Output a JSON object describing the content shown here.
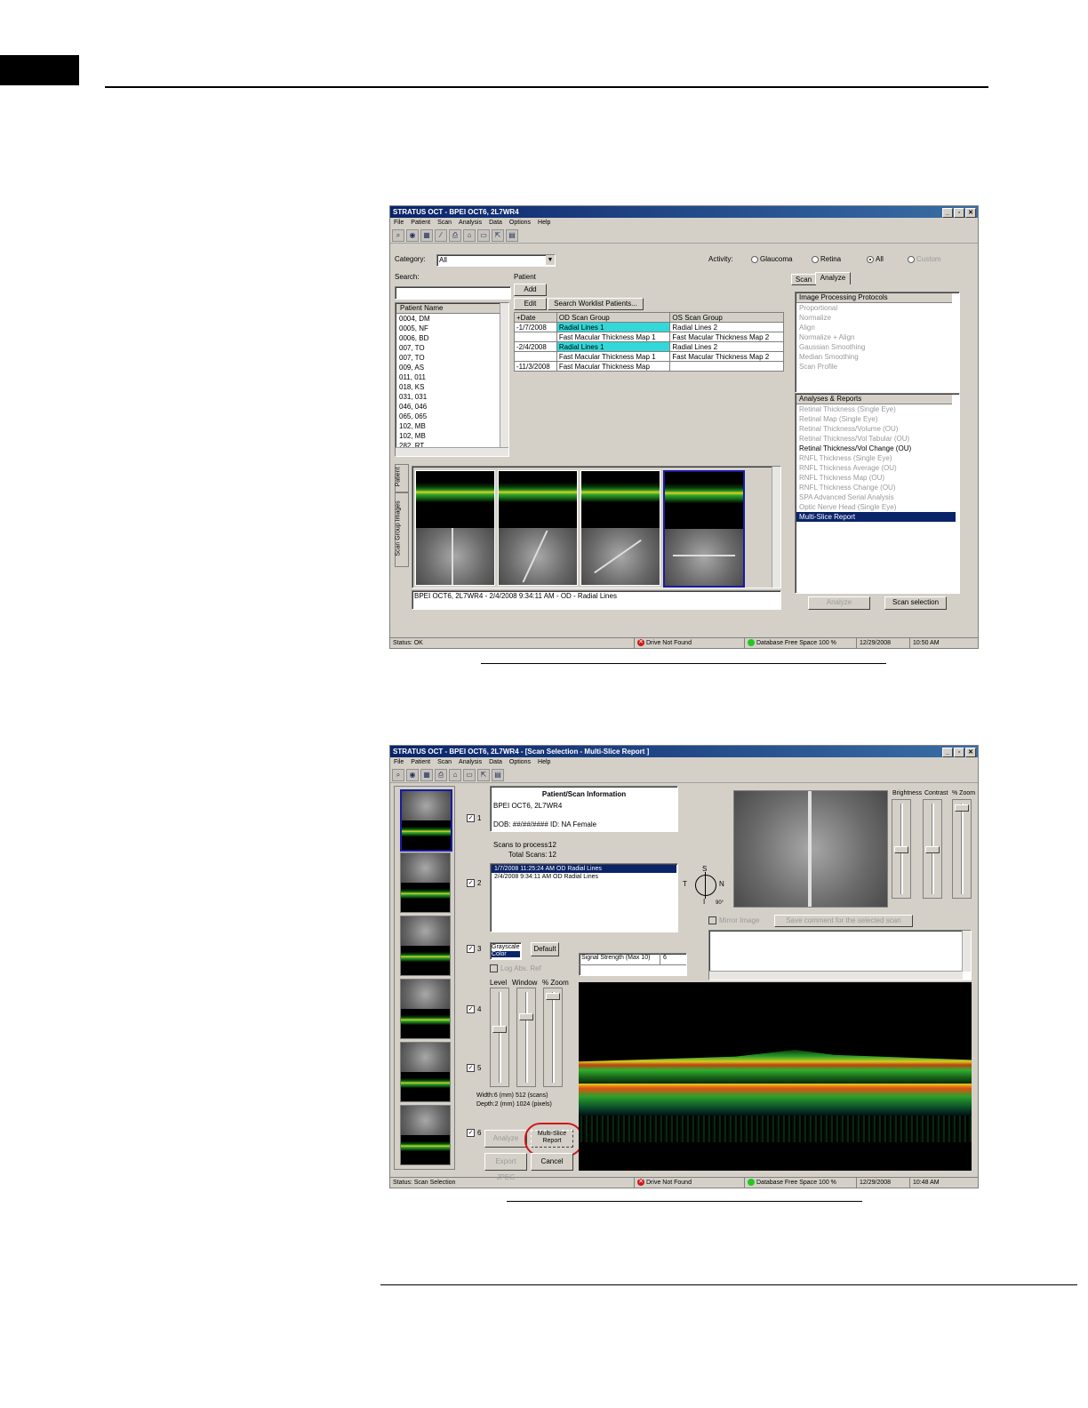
{
  "window1": {
    "title": "STRATUS OCT - BPEI OCT6, 2L7WR4",
    "menu": [
      "File",
      "Patient",
      "Scan",
      "Analysis",
      "Data",
      "Options",
      "Help"
    ],
    "category_label": "Category:",
    "category_value": "All",
    "activity_label": "Activity:",
    "activity_options": [
      "Glaucoma",
      "Retina",
      "All",
      "Custom"
    ],
    "search_label": "Search:",
    "patient_label": "Patient",
    "add_btn": "Add",
    "edit_btn": "Edit",
    "search_worklist_btn": "Search Worklist Patients...",
    "patient_list_header": "Patient Name",
    "patients": [
      "0004, DM",
      "0005, NF",
      "0006, BD",
      "007, TO",
      "007, TO",
      "009, AS",
      "011, 011",
      "018, KS",
      "031, 031",
      "046, 046",
      "065, 065",
      "102, MB",
      "102, MB",
      "282, RT"
    ],
    "table_headers": [
      "Date",
      "OD Scan Group",
      "OS Scan Group"
    ],
    "table_rows": [
      [
        "-1/7/2008",
        "Radial Lines 1",
        "Radial Lines 2"
      ],
      [
        "",
        "Fast Macular Thickness Map 1",
        "Fast Macular Thickness Map 2"
      ],
      [
        "-2/4/2008",
        "Radial Lines 1",
        "Radial Lines 2"
      ],
      [
        "",
        "Fast Macular Thickness Map 1",
        "Fast Macular Thickness Map 2"
      ],
      [
        "-11/3/2008",
        "Fast Macular Thickness Map",
        ""
      ]
    ],
    "tabs": [
      "Scan",
      "Analyze"
    ],
    "ipp_header": "Image Processing Protocols",
    "ipp_items": [
      "Proportional",
      "Normalize",
      "Align",
      "Normalize + Align",
      "Gaussian Smoothing",
      "Median Smoothing",
      "Scan Profile"
    ],
    "ar_header": "Analyses & Reports",
    "ar_items": [
      "Retinal Thickness (Single Eye)",
      "Retinal Map (Single Eye)",
      "Retinal Thickness/Volume (OU)",
      "Retinal Thickness/Vol Tabular (OU)",
      "Retinal Thickness/Vol Change (OU)",
      "RNFL Thickness (Single Eye)",
      "RNFL Thickness Average (OU)",
      "RNFL Thickness Map (OU)",
      "RNFL Thickness Change (OU)",
      "SPA Advanced Serial Analysis",
      "Optic Nerve Head (Single Eye)",
      "Multi-Slice Report"
    ],
    "side_tabs": [
      "Patient",
      "Scan Group Images"
    ],
    "image_caption": "BPEI OCT6, 2L7WR4 - 2/4/2008 9:34:11 AM - OD - Radial Lines",
    "analyze_btn": "Analyze",
    "scan_selection_btn": "Scan selection",
    "status": {
      "left": "Status: OK",
      "drive": "Drive Not Found",
      "db": "Database Free Space 100 %",
      "date": "12/29/2008",
      "time": "10:50 AM"
    }
  },
  "window2": {
    "title": "STRATUS OCT - BPEI OCT6, 2L7WR4 - [Scan Selection - Multi-Slice Report ]",
    "menu": [
      "File",
      "Patient",
      "Scan",
      "Analysis",
      "Data",
      "Options",
      "Help"
    ],
    "info_title": "Patient/Scan Information",
    "info_name": "BPEI OCT6, 2L7WR4",
    "info_dob": "DOB: ##/##/####  ID: NA Female",
    "scans_to_process_label": "Scans to process:",
    "scans_to_process": "12",
    "total_scans_label": "Total Scans:",
    "total_scans": "12",
    "scan_list": [
      "1/7/2008 11:25:24 AM OD Radial Lines",
      "2/4/2008 9:34:11 AM OD Radial Lines"
    ],
    "checkbox_labels": [
      "1",
      "2",
      "3",
      "4",
      "5",
      "6"
    ],
    "color_options": [
      "Grayscale",
      "Color"
    ],
    "default_btn": "Default",
    "log_abs_label": "Log Abs. Ref",
    "signal_strength_label": "Signal Strength (Max 10)",
    "signal_strength_value": "6",
    "slider_labels": [
      "Level",
      "Window",
      "% Zoom"
    ],
    "top_slider_labels": [
      "Brightness",
      "Contrast",
      "% Zoom"
    ],
    "compass": {
      "s": "S",
      "n": "N",
      "t": "T",
      "i": "I",
      "deg": "90°"
    },
    "mirror_label": "Mirror Image",
    "save_comment_btn": "Save comment for the selected scan",
    "width_text": "Width:6 (mm) 512 (scans)",
    "depth_text": "Depth:2 (mm) 1024 (pixels)",
    "analyze_btn": "Analyze",
    "multislice_btn": "Multi-Slice Report",
    "export_btn": "Export JPEG",
    "cancel_btn": "Cancel",
    "status": {
      "left": "Status: Scan Selection",
      "drive": "Drive Not Found",
      "db": "Database Free Space 100 %",
      "date": "12/29/2008",
      "time": "10:48 AM"
    }
  },
  "colors": {
    "title_start": "#0a246a",
    "highlight": "#33d8d8",
    "callout": "#d01818"
  }
}
